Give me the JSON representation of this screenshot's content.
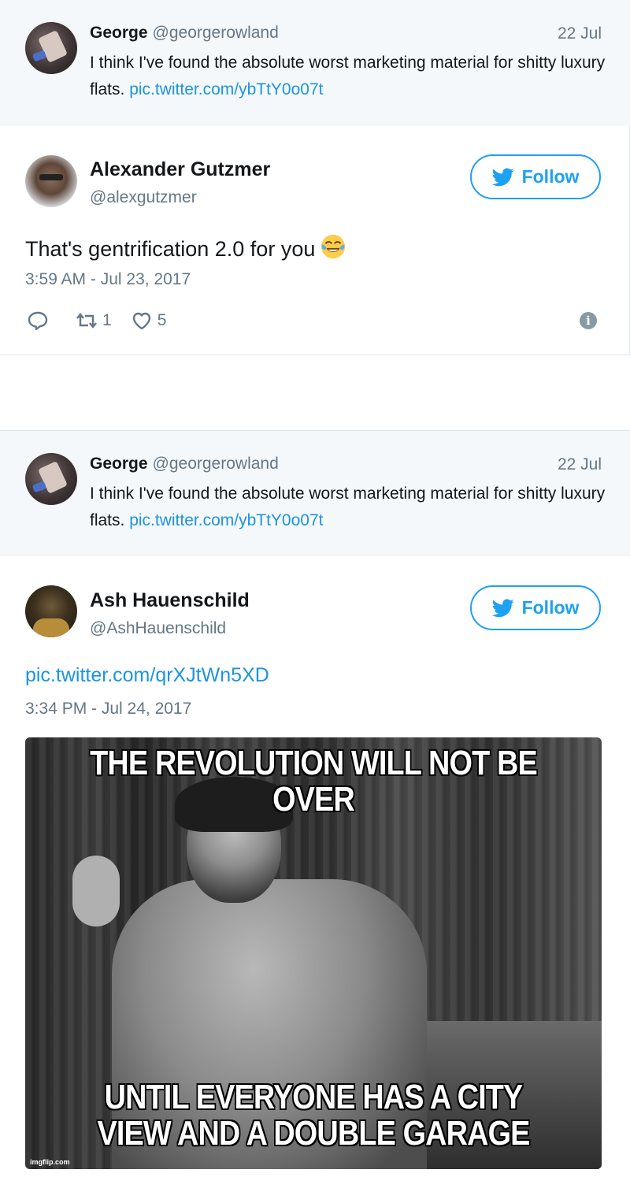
{
  "quoted_tweet": {
    "name": "George",
    "handle": "@georgerowland",
    "date": "22 Jul",
    "text": "I think I've found the absolute worst marketing material for shitty luxury flats.",
    "link": "pic.twitter.com/ybTtY0o07t"
  },
  "tweet_1": {
    "name": "Alexander Gutzmer",
    "handle": "@alexgutzmer",
    "follow_label": "Follow",
    "text": "That's gentrification 2.0 for you",
    "emoji": "face-with-tears-of-joy",
    "timestamp": "3:59 AM - Jul 23, 2017",
    "retweet_count": "1",
    "like_count": "5"
  },
  "tweet_2": {
    "name": "Ash Hauenschild",
    "handle": "@AshHauenschild",
    "follow_label": "Follow",
    "link": "pic.twitter.com/qrXJtWn5XD",
    "timestamp": "3:34 PM - Jul 24, 2017",
    "meme_top": "THE REVOLUTION WILL NOT BE OVER",
    "meme_bottom_line1": "UNTIL EVERYONE HAS A CITY",
    "meme_bottom_line2": "VIEW AND A DOUBLE GARAGE",
    "watermark": "imgflip.com"
  },
  "colors": {
    "accent": "#1da1f2",
    "link": "#1b95e0",
    "muted": "#657786",
    "quote_bg": "#f5f8fa"
  }
}
